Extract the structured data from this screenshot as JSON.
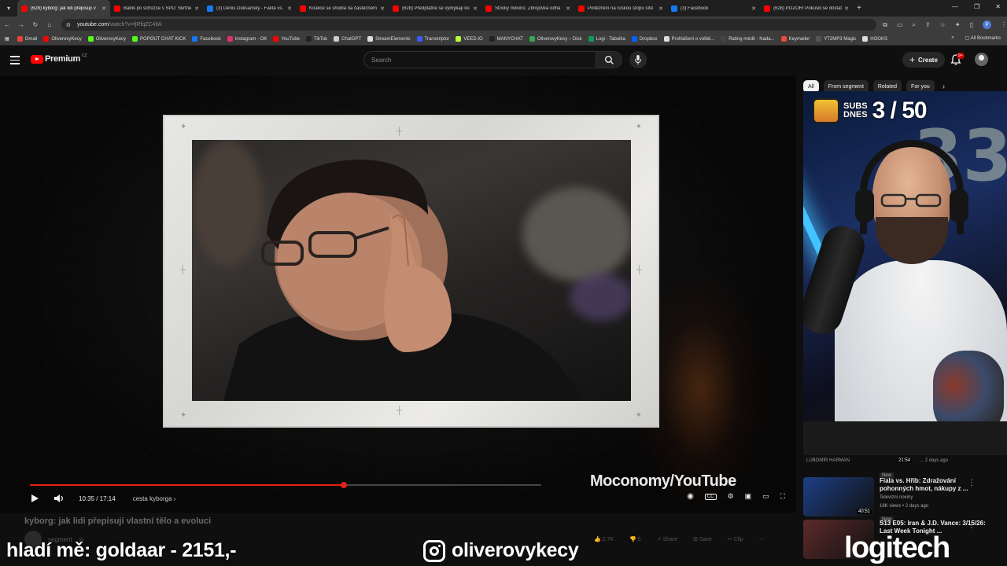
{
  "browser": {
    "tabs": [
      {
        "title": "(628) kyborg: jak lidi přepisují v",
        "color": "#ff0000",
        "active": true
      },
      {
        "title": "Babiš po schůzce s SPD: Škrtne",
        "color": "#ff0000",
        "active": false
      },
      {
        "title": "(3) Denis Doksanský - Fakta vs.",
        "color": "#1877f2",
        "active": false
      },
      {
        "title": "Koalice se shodla na částečném",
        "color": "#ff0000",
        "active": false
      },
      {
        "title": "(628) Předplatné se vymykají ko",
        "color": "#ff0000",
        "active": false
      },
      {
        "title": "Stovky milionů. Zbrojovka odha",
        "color": "#ff0000",
        "active": false
      },
      {
        "title": "Podezření na ruskou stopu sítě",
        "color": "#ff0000",
        "active": false
      },
      {
        "title": "(3) Facebook",
        "color": "#1877f2",
        "active": false
      },
      {
        "title": "(628) POZOR! Pokusili se dostat",
        "color": "#ff0000",
        "active": false
      }
    ],
    "url_host": "youtube.com",
    "url_path": "/watch?v=fjRfqZC4itA",
    "bookmarks": [
      {
        "label": "Gmail",
        "color": "#ea4335"
      },
      {
        "label": "OliverovyKecy",
        "color": "#ff0000"
      },
      {
        "label": "OliverovyKecy",
        "color": "#53fc18"
      },
      {
        "label": "POPOUT CHAT KICK",
        "color": "#53fc18"
      },
      {
        "label": "Facebook",
        "color": "#1877f2"
      },
      {
        "label": "Instagram - OK",
        "color": "#e1306c"
      },
      {
        "label": "YouTube",
        "color": "#ff0000"
      },
      {
        "label": "TikTok",
        "color": "#222222"
      },
      {
        "label": "ChatGPT",
        "color": "#cccccc"
      },
      {
        "label": "StreamElements",
        "color": "#dddddd"
      },
      {
        "label": "Transkriptor",
        "color": "#3a5bff"
      },
      {
        "label": "VEED.IO",
        "color": "#b8ff35"
      },
      {
        "label": "MANYCHAT",
        "color": "#222222"
      },
      {
        "label": "OliverovyKecy – Disk",
        "color": "#34a853"
      },
      {
        "label": "Logi - Tabulka",
        "color": "#0f9d58"
      },
      {
        "label": "Dropbox",
        "color": "#0061ff"
      },
      {
        "label": "Prohlášení o volbě...",
        "color": "#dddddd"
      },
      {
        "label": "Rating médií - Nada...",
        "color": "#444444"
      },
      {
        "label": "Keymailer",
        "color": "#e94b3c"
      },
      {
        "label": "YT2MP3 Magic",
        "color": "#555555"
      },
      {
        "label": "HOOKS",
        "color": "#dddddd"
      }
    ],
    "all_bookmarks": "All Bookmarks",
    "profile_initial": "P"
  },
  "youtube": {
    "logo_text": "Premium",
    "logo_region": "CZ",
    "search_placeholder": "Search",
    "create_label": "Create",
    "notif_count": "9+"
  },
  "player": {
    "watermark": "Moconomy/YouTube",
    "time": "10:35 / 17:14",
    "chapter": "cesta kyborga",
    "progress": 0.614,
    "buffered": 1.0
  },
  "video": {
    "title": "kyborg: jak lidi přepisují vlastní tělo a evoluci",
    "channel": "segment",
    "likes": "2.7K",
    "dislikes": "5",
    "share": "Share",
    "save": "Save",
    "clip": "Clip"
  },
  "sidebar": {
    "chips": [
      "All",
      "From segment",
      "Related",
      "For you"
    ],
    "top_item": {
      "channel": "LUBOMIR HARMAN",
      "duration": "21:54",
      "meta": "... 2 days ago",
      "badge": "New"
    },
    "recommendations": [
      {
        "title": "Fiala vs. Hřib: Zdražování pohonných hmot, nákupy z ...",
        "channel": "Televizní noviny",
        "views": "18K views • 2 days ago",
        "badge": "New",
        "duration": "40:51",
        "thumb_color": "#1d3f86"
      },
      {
        "title": "S13 E05: Iran & J.D. Vance: 3/15/26: Last Week Tonight ...",
        "channel": "",
        "views": "",
        "badge": "",
        "duration": "",
        "thumb_color": "#5c2a2a"
      }
    ]
  },
  "webcam": {
    "subs_label_1": "SUBS",
    "subs_label_2": "DNES",
    "subs_count": "3 / 50",
    "balloon_digits": "33"
  },
  "stream_overlay": {
    "donation": "hladí mě: goldaar - 2151,-",
    "instagram": "oliverovykecy",
    "sponsor": "logitech"
  }
}
